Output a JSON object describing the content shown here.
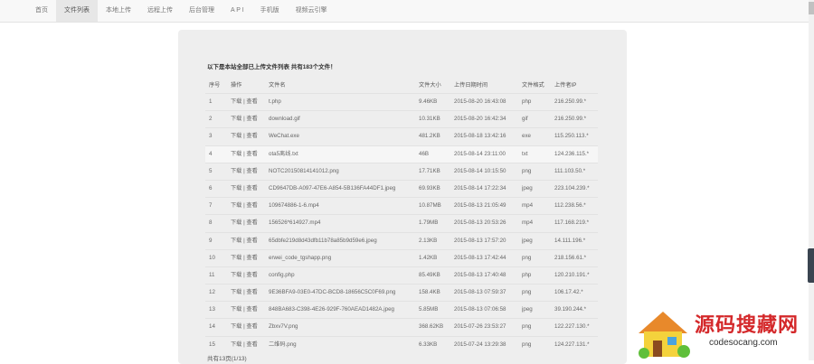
{
  "nav": {
    "items": [
      {
        "label": "首页"
      },
      {
        "label": "文件列表"
      },
      {
        "label": "本地上传"
      },
      {
        "label": "远程上传"
      },
      {
        "label": "后台管理"
      },
      {
        "label": "A P I"
      },
      {
        "label": "手机版"
      },
      {
        "label": "视频云引擎"
      }
    ],
    "active_index": 1
  },
  "panel": {
    "heading": "以下是本站全部已上传文件列表 共有183个文件！",
    "columns": [
      "序号",
      "操作",
      "文件名",
      "文件大小",
      "上传日期时间",
      "文件格式",
      "上传者IP"
    ],
    "download_label": "下载",
    "separator": " | ",
    "view_label": "查看",
    "rows": [
      {
        "index": "1",
        "name": "t.php",
        "size": "9.46KB",
        "date": "2015-08-20 16:43:08",
        "format": "php",
        "ip": "216.250.99.*"
      },
      {
        "index": "2",
        "name": "download.gif",
        "size": "10.31KB",
        "date": "2015-08-20 16:42:34",
        "format": "gif",
        "ip": "216.250.99.*"
      },
      {
        "index": "3",
        "name": "WeChat.exe",
        "size": "481.2KB",
        "date": "2015-08-18 13:42:16",
        "format": "exe",
        "ip": "115.250.113.*"
      },
      {
        "index": "4",
        "name": "ota5离线.txt",
        "size": "46B",
        "date": "2015-08-14 23:11:00",
        "format": "txt",
        "ip": "124.236.115.*"
      },
      {
        "index": "5",
        "name": "NOTC20150814141012.png",
        "size": "17.71KB",
        "date": "2015-08-14 10:15:50",
        "format": "png",
        "ip": "111.103.50.*"
      },
      {
        "index": "6",
        "name": "CD9647DB-A097-47E6-A854-5B136FA44DF1.jpeg",
        "size": "69.93KB",
        "date": "2015-08-14 17:22:34",
        "format": "jpeg",
        "ip": "223.104.239.*"
      },
      {
        "index": "7",
        "name": "109674886-1-6.mp4",
        "size": "10.87MB",
        "date": "2015-08-13 21:05:49",
        "format": "mp4",
        "ip": "112.238.56.*"
      },
      {
        "index": "8",
        "name": "156526*614927.mp4",
        "size": "1.79MB",
        "date": "2015-08-13 20:53:26",
        "format": "mp4",
        "ip": "117.168.219.*"
      },
      {
        "index": "9",
        "name": "65dbfe219d8d43dfb11b78a85b9d59e6.jpeg",
        "size": "2.13KB",
        "date": "2015-08-13 17:57:20",
        "format": "jpeg",
        "ip": "14.111.196.*"
      },
      {
        "index": "10",
        "name": "erwei_code_tgshapp.png",
        "size": "1.42KB",
        "date": "2015-08-13 17:42:44",
        "format": "png",
        "ip": "218.156.61.*"
      },
      {
        "index": "11",
        "name": "config.php",
        "size": "85.49KB",
        "date": "2015-08-13 17:40:48",
        "format": "php",
        "ip": "120.210.191.*"
      },
      {
        "index": "12",
        "name": "9E36BFA9-03E0-47DC-BCD8-18656C5C0F69.png",
        "size": "158.4KB",
        "date": "2015-08-13 07:59:37",
        "format": "png",
        "ip": "106.17.42.*"
      },
      {
        "index": "13",
        "name": "848BA683-C398-4E26-929F-760AEAD1482A.jpeg",
        "size": "5.85MB",
        "date": "2015-08-13 07:06:58",
        "format": "jpeg",
        "ip": "39.190.244.*"
      },
      {
        "index": "14",
        "name": "Zbxv7V.png",
        "size": "368.62KB",
        "date": "2015-07-26 23:53:27",
        "format": "png",
        "ip": "122.227.130.*"
      },
      {
        "index": "15",
        "name": "二维码.png",
        "size": "6.33KB",
        "date": "2015-07-24 13:29:38",
        "format": "png",
        "ip": "124.227.131.*"
      }
    ],
    "highlight_row_index": 3,
    "footer": "共有13页(1/13)"
  },
  "watermark": {
    "text": "源码搜藏网",
    "url": "codesocang.com",
    "color": "#d4282a"
  }
}
